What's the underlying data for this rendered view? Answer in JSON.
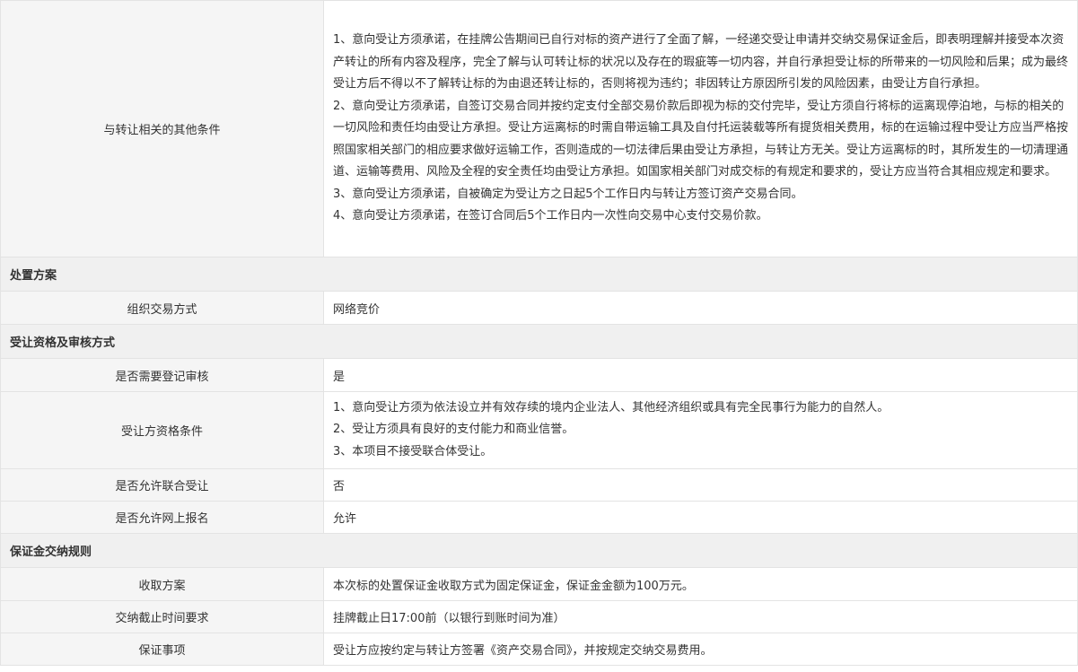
{
  "other_conditions": {
    "label": "与转让相关的其他条件",
    "paragraphs": [
      "1、意向受让方须承诺，在挂牌公告期间已自行对标的资产进行了全面了解，一经递交受让申请并交纳交易保证金后，即表明理解并接受本次资产转让的所有内容及程序，完全了解与认可转让标的状况以及存在的瑕疵等一切内容，并自行承担受让标的所带来的一切风险和后果；成为最终受让方后不得以不了解转让标的为由退还转让标的，否则将视为违约；非因转让方原因所引发的风险因素，由受让方自行承担。",
      "2、意向受让方须承诺，自签订交易合同并按约定支付全部交易价款后即视为标的交付完毕，受让方须自行将标的运离现停泊地，与标的相关的一切风险和责任均由受让方承担。受让方运离标的时需自带运输工具及自付托运装载等所有提货相关费用，标的在运输过程中受让方应当严格按照国家相关部门的相应要求做好运输工作，否则造成的一切法律后果由受让方承担，与转让方无关。受让方运离标的时，其所发生的一切清理通道、运输等费用、风险及全程的安全责任均由受让方承担。如国家相关部门对成交标的有规定和要求的，受让方应当符合其相应规定和要求。",
      "3、意向受让方须承诺，自被确定为受让方之日起5个工作日内与转让方签订资产交易合同。",
      "4、意向受让方须承诺，在签订合同后5个工作日内一次性向交易中心支付交易价款。"
    ]
  },
  "sections": {
    "disposal": "处置方案",
    "qualification": "受让资格及审核方式",
    "deposit": "保证金交纳规则"
  },
  "rows": {
    "trade_method": {
      "label": "组织交易方式",
      "value": "网络竞价"
    },
    "need_review": {
      "label": "是否需要登记审核",
      "value": "是"
    },
    "buyer_conditions": {
      "label": "受让方资格条件",
      "paragraphs": [
        "1、意向受让方须为依法设立并有效存续的境内企业法人、其他经济组织或具有完全民事行为能力的自然人。",
        "2、受让方须具有良好的支付能力和商业信誉。",
        "3、本项目不接受联合体受让。"
      ]
    },
    "allow_joint": {
      "label": "是否允许联合受让",
      "value": "否"
    },
    "allow_online": {
      "label": "是否允许网上报名",
      "value": "允许"
    },
    "collect_plan": {
      "label": "收取方案",
      "value": "本次标的处置保证金收取方式为固定保证金，保证金金额为100万元。"
    },
    "deadline": {
      "label": "交纳截止时间要求",
      "value": "挂牌截止日17:00前（以银行到账时间为准）"
    },
    "deposit_matters": {
      "label": "保证事项",
      "value": "受让方应按约定与转让方签署《资产交易合同》，并按规定交纳交易费用。"
    }
  }
}
